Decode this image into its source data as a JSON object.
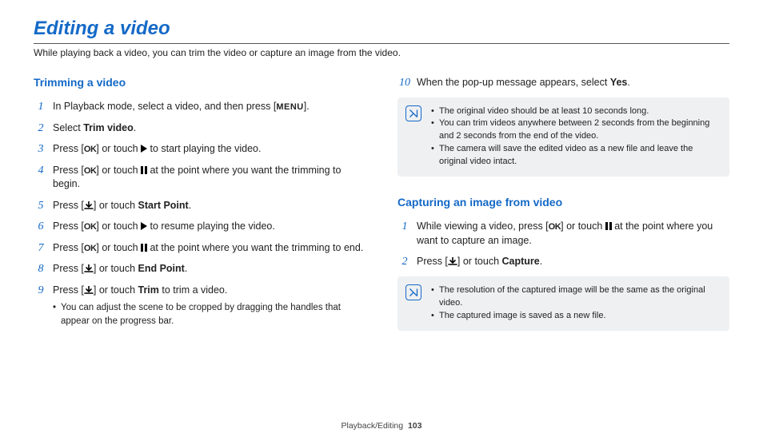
{
  "title": "Editing a video",
  "intro": "While playing back a video, you can trim the video or capture an image from the video.",
  "section_trim": {
    "heading": "Trimming a video",
    "steps": [
      {
        "pre": "In Playback mode, select a video, and then press [",
        "iconKey": "menu",
        "post": "]."
      },
      {
        "pre": "Select ",
        "bold": "Trim video",
        "post": "."
      },
      {
        "pre": "Press [",
        "iconKey": "ok",
        "mid": "] or touch ",
        "icon2": "play",
        "post": " to start playing the video."
      },
      {
        "pre": "Press [",
        "iconKey": "ok",
        "mid": "] or touch ",
        "icon2": "pause",
        "post": " at the point where you want the trimming to begin."
      },
      {
        "pre": "Press [",
        "iconKey": "down",
        "mid": "] or touch ",
        "bold": "Start Point",
        "post": "."
      },
      {
        "pre": "Press [",
        "iconKey": "ok",
        "mid": "] or touch ",
        "icon2": "play",
        "post": " to resume playing the video."
      },
      {
        "pre": "Press [",
        "iconKey": "ok",
        "mid": "] or touch ",
        "icon2": "pause",
        "post": " at the point where you want the trimming to end."
      },
      {
        "pre": "Press [",
        "iconKey": "down",
        "mid": "] or touch ",
        "bold": "End Point",
        "post": "."
      },
      {
        "pre": "Press [",
        "iconKey": "down",
        "mid": "] or touch ",
        "bold": "Trim",
        "post": " to trim a video."
      }
    ],
    "subnote": [
      "You can adjust the scene to be cropped by dragging the handles that appear on the progress bar."
    ]
  },
  "section_trim_cont": {
    "step10": {
      "pre": "When the pop-up message appears, select ",
      "bold": "Yes",
      "post": "."
    },
    "info": [
      "The original video should be at least 10 seconds long.",
      "You can trim videos anywhere between 2 seconds from the beginning and 2 seconds from the end of the video.",
      "The camera will save the edited video as a new file and leave the original video intact."
    ]
  },
  "section_capture": {
    "heading": "Capturing an image from video",
    "steps": [
      {
        "pre": "While viewing a video, press [",
        "iconKey": "ok",
        "mid": "] or touch ",
        "icon2": "pause",
        "post": " at the point where you want to capture an image."
      },
      {
        "pre": "Press [",
        "iconKey": "down",
        "mid": "] or touch ",
        "bold": "Capture",
        "post": "."
      }
    ],
    "info": [
      "The resolution of the captured image will be the same as the original video.",
      "The captured image is saved as a new file."
    ]
  },
  "footer": {
    "section": "Playback/Editing",
    "page": "103"
  },
  "icons": {
    "menu": "MENU",
    "ok": "OK"
  }
}
